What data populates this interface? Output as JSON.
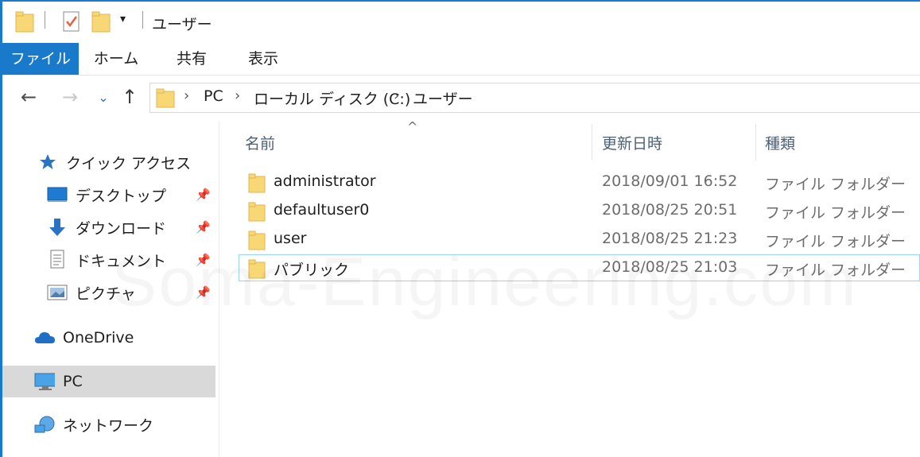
{
  "window": {
    "title": "ユーザー"
  },
  "ribbon": {
    "tabs": [
      "ファイル",
      "ホーム",
      "共有",
      "表示"
    ]
  },
  "address": {
    "segments": [
      "PC",
      "ローカル ディスク (C:)",
      "ユーザー"
    ]
  },
  "sidebar": {
    "quick_access": "クイック アクセス",
    "pinned": [
      {
        "label": "デスクトップ",
        "icon": "desktop-icon"
      },
      {
        "label": "ダウンロード",
        "icon": "download-arrow-icon"
      },
      {
        "label": "ドキュメント",
        "icon": "document-icon"
      },
      {
        "label": "ピクチャ",
        "icon": "picture-icon"
      }
    ],
    "onedrive": "OneDrive",
    "pc": "PC",
    "network": "ネットワーク"
  },
  "columns": {
    "name": "名前",
    "modified": "更新日時",
    "type": "種類"
  },
  "files": [
    {
      "name": "administrator",
      "modified": "2018/09/01 16:52",
      "type": "ファイル フォルダー"
    },
    {
      "name": "defaultuser0",
      "modified": "2018/08/25 20:51",
      "type": "ファイル フォルダー"
    },
    {
      "name": "user",
      "modified": "2018/08/25 21:23",
      "type": "ファイル フォルダー"
    },
    {
      "name": "パブリック",
      "modified": "2018/08/25 21:03",
      "type": "ファイル フォルダー"
    }
  ],
  "watermark": "Soma-Engineering.com",
  "colors": {
    "accent": "#1979ca",
    "folder": "#f8d775",
    "header_text": "#4c607a"
  }
}
